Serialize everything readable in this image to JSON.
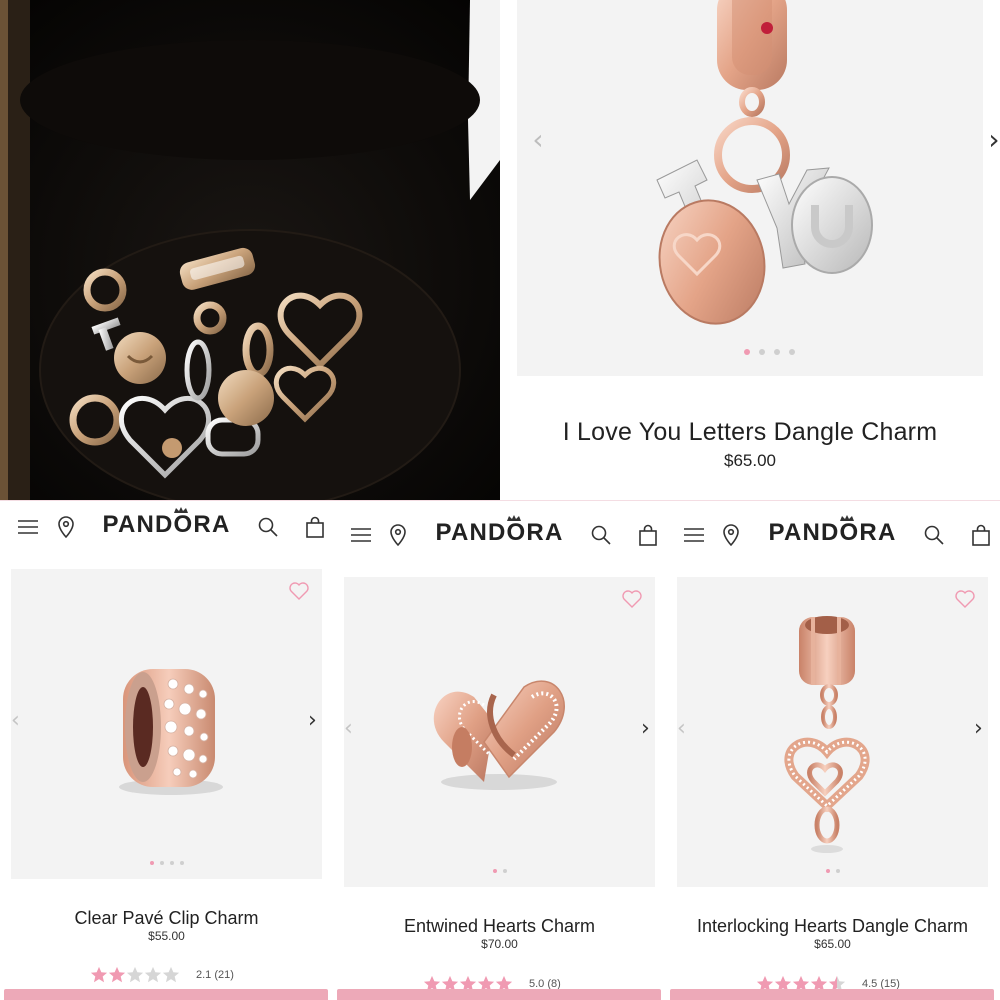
{
  "colors": {
    "accent_pink": "#f09ab2",
    "cta_pink": "#eda9b8",
    "card_bg": "#f3f3f3",
    "rose_gold": "#e6a590"
  },
  "hero": {
    "name": "I Love You Letters Dangle Charm",
    "price": "$65.00",
    "slides": 4,
    "active_slide": 1
  },
  "brand": {
    "logo": "PANDORA"
  },
  "products": [
    {
      "name": "Clear Pavé Clip Charm",
      "price": "$55.00",
      "rating": 2.1,
      "rating_text": "2.1 (21)",
      "slides": 4
    },
    {
      "name": "Entwined Hearts Charm",
      "price": "$70.00",
      "rating": 5.0,
      "rating_text": "5.0 (8)",
      "slides": 2
    },
    {
      "name": "Interlocking Hearts Dangle Charm",
      "price": "$65.00",
      "rating": 4.5,
      "rating_text": "4.5 (15)",
      "slides": 2
    }
  ],
  "icons": {
    "menu": "menu-icon",
    "location": "location-pin-icon",
    "search": "search-icon",
    "bag": "shopping-bag-icon",
    "wishlist": "heart-outline-icon"
  }
}
